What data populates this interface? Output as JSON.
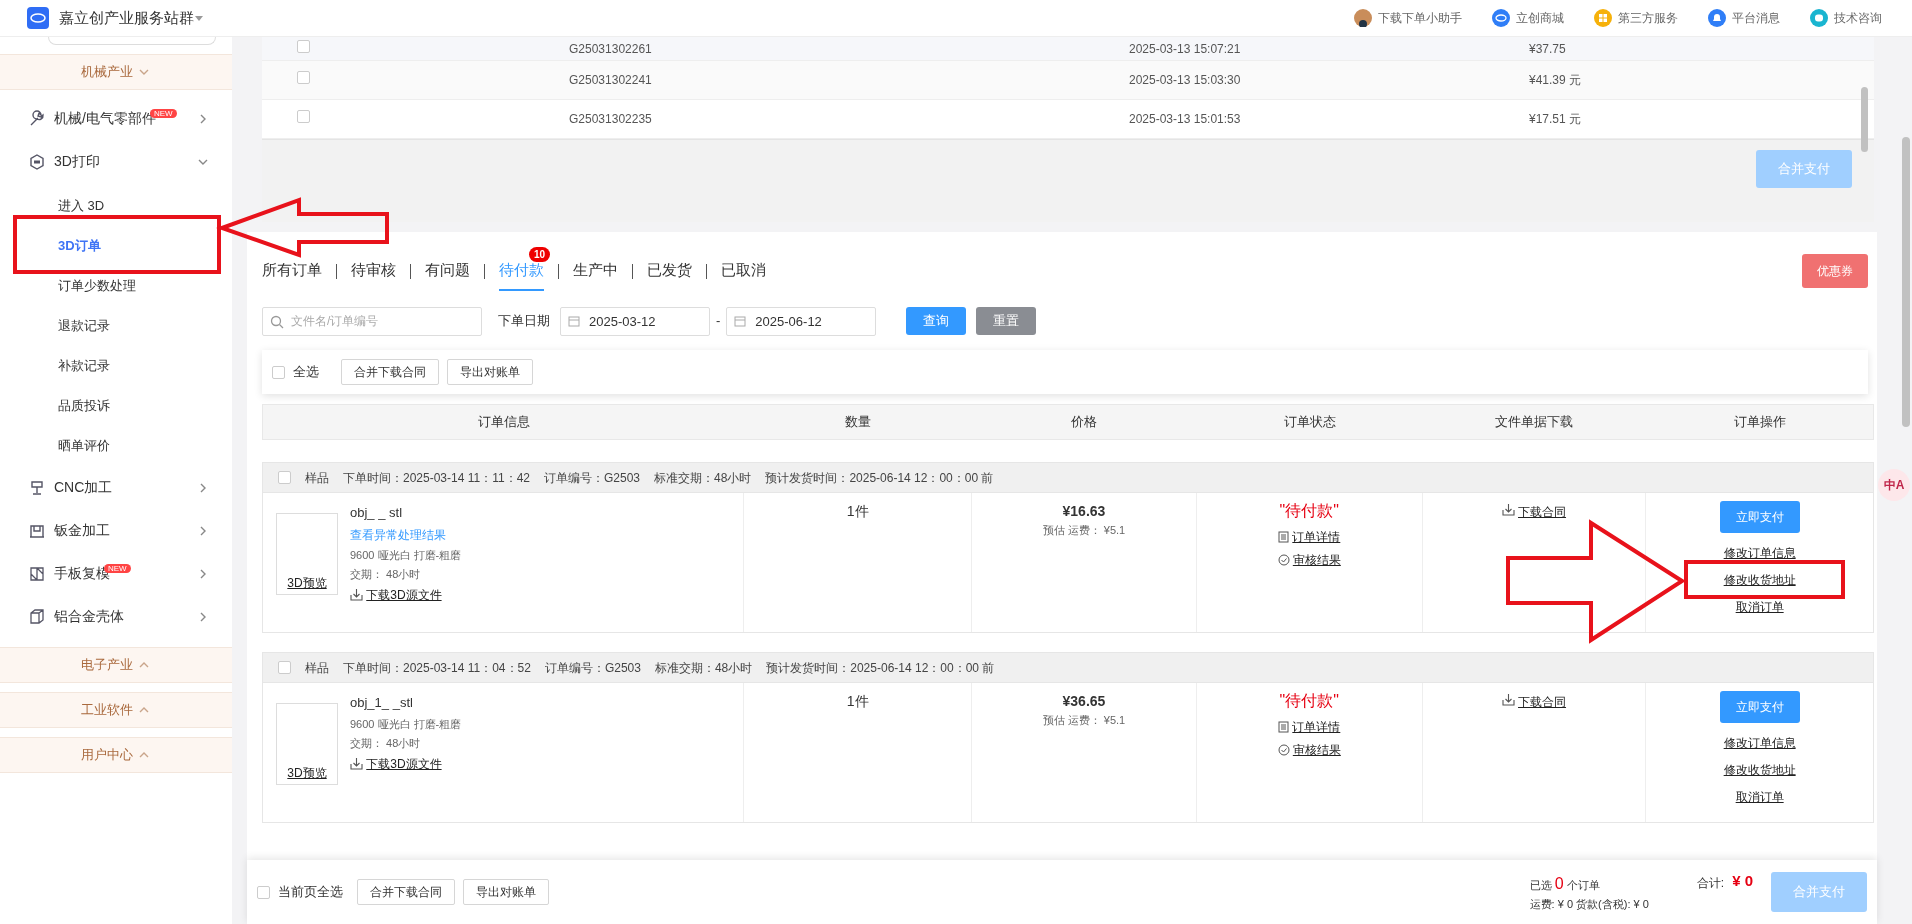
{
  "header": {
    "title": "嘉立创产业服务站群",
    "links": [
      {
        "label": "下载下单小助手"
      },
      {
        "label": "立创商城"
      },
      {
        "label": "第三方服务"
      },
      {
        "label": "平台消息"
      },
      {
        "label": "技术咨询"
      }
    ]
  },
  "sidebar": {
    "sections": [
      {
        "label": "机械产业",
        "expanded": true,
        "items": [
          {
            "label": "机械/电气零部件",
            "badge": "NEW",
            "expanded": false
          },
          {
            "label": "3D打印",
            "expanded": true,
            "children": [
              {
                "label": "进入 3D",
                "selected": false
              },
              {
                "label": "3D订单",
                "selected": true
              },
              {
                "label": "订单少数处理",
                "selected": false
              },
              {
                "label": "退款记录",
                "selected": false
              },
              {
                "label": "补款记录",
                "selected": false
              },
              {
                "label": "品质投诉",
                "selected": false
              },
              {
                "label": "晒单评价",
                "selected": false
              }
            ]
          },
          {
            "label": "CNC加工",
            "expanded": false
          },
          {
            "label": "钣金加工",
            "expanded": false
          },
          {
            "label": "手板复模",
            "badge": "NEW",
            "expanded": false
          },
          {
            "label": "铝合金壳体",
            "expanded": false
          }
        ]
      },
      {
        "label": "电子产业",
        "expanded": false
      },
      {
        "label": "工业软件",
        "expanded": false
      },
      {
        "label": "用户中心",
        "expanded": false
      }
    ]
  },
  "pending_payments": {
    "rows": [
      {
        "checked": false,
        "order_no": "G25031302261",
        "time": "2025-03-13 15:07:21",
        "amount": "¥37.75"
      },
      {
        "checked": false,
        "order_no": "G25031302241",
        "time": "2025-03-13 15:03:30",
        "amount": "¥41.39 元"
      },
      {
        "checked": false,
        "order_no": "G25031302235",
        "time": "2025-03-13 15:01:53",
        "amount": "¥17.51 元"
      }
    ],
    "button": {
      "label": "合并支付",
      "disabled": true
    }
  },
  "tabs": [
    {
      "label": "所有订单",
      "selected": false
    },
    {
      "label": "待审核",
      "selected": false
    },
    {
      "label": "有问题",
      "selected": false
    },
    {
      "label": "待付款",
      "selected": true,
      "badge": "10"
    },
    {
      "label": "生产中",
      "selected": false
    },
    {
      "label": "已发货",
      "selected": false
    },
    {
      "label": "已取消",
      "selected": false
    }
  ],
  "coupon_button": "优惠券",
  "filters": {
    "search": {
      "placeholder": "文件名/订单编号"
    },
    "date_label": "下单日期",
    "date_from": "2025-03-12",
    "date_separator": "-",
    "date_to": "2025-06-12",
    "query_button": "查询",
    "reset_button": "重置"
  },
  "toolbar": {
    "select_all": {
      "label": "全选",
      "checked": false
    },
    "buttons": [
      "合并下载合同",
      "导出对账单"
    ]
  },
  "table": {
    "columns": [
      "订单信息",
      "数量",
      "价格",
      "订单状态",
      "文件单据下载",
      "订单操作"
    ]
  },
  "orders": [
    {
      "checked": false,
      "tag": "样品",
      "meta": [
        "下单时间：2025-03-14 11：11：42",
        "订单编号：G2503",
        "标准交期：48小时",
        "预计发货时间：2025-06-14 12：00：00 前"
      ],
      "preview": "3D预览",
      "file_name": "obj_ _ stl",
      "exception_link": "查看异常处理结果",
      "spec": "9600 哑光白 打磨-粗磨",
      "lead_time": "交期： 48小时",
      "download": "下载3D源文件",
      "quantity": "1件",
      "price": "¥16.63",
      "shipping": "预估 运费： ¥5.1",
      "status": "\"待付款\"",
      "status_links": [
        "订单详情",
        "审核结果"
      ],
      "contract": "下载合同",
      "pay_button": "立即支付",
      "actions": [
        "修改订单信息",
        "修改收货地址",
        "取消订单"
      ]
    },
    {
      "checked": false,
      "tag": "样品",
      "meta": [
        "下单时间：2025-03-14 11：04：52",
        "订单编号：G2503",
        "标准交期：48小时",
        "预计发货时间：2025-06-14 12：00：00 前"
      ],
      "preview": "3D预览",
      "file_name": "obj_1_ _stl",
      "spec": "9600 哑光白 打磨-粗磨",
      "lead_time": "交期： 48小时",
      "download": "下载3D源文件",
      "quantity": "1件",
      "price": "¥36.65",
      "shipping": "预估 运费： ¥5.1",
      "status": "\"待付款\"",
      "status_links": [
        "订单详情",
        "审核结果"
      ],
      "contract": "下载合同",
      "pay_button": "立即支付",
      "actions": [
        "修改订单信息",
        "修改收货地址",
        "取消订单"
      ]
    }
  ],
  "footer": {
    "select_page": {
      "label": "当前页全选",
      "checked": false
    },
    "buttons": [
      "合并下载合同",
      "导出对账单"
    ],
    "selected_prefix": "已选",
    "selected_count": "0",
    "selected_suffix": "个订单",
    "fees": "运费: ¥ 0 货款(含税): ¥ 0",
    "total_label": "合计:",
    "total": "¥ 0",
    "pay_button": {
      "label": "合并支付",
      "disabled": true
    }
  },
  "translate_button": "中A"
}
